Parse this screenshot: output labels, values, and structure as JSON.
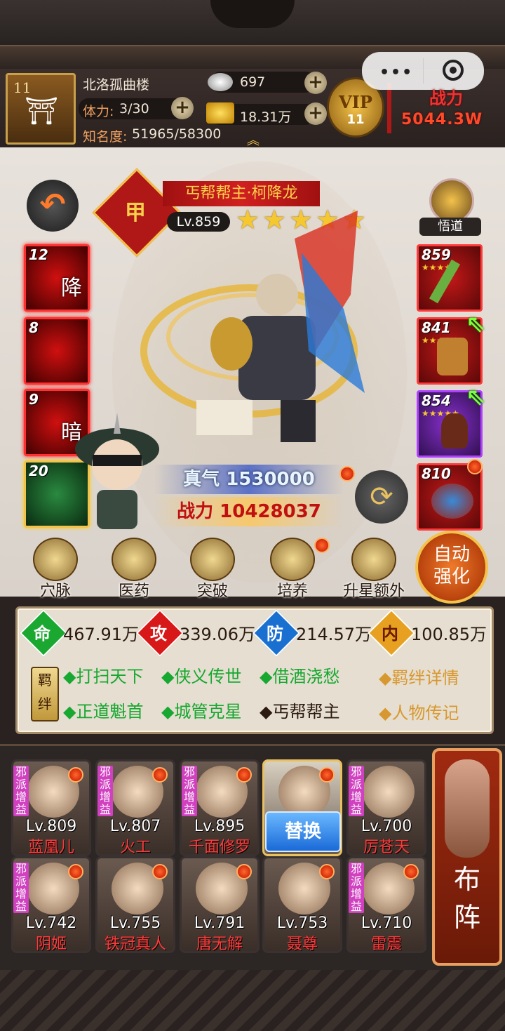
{
  "header": {
    "level": "11",
    "location": "北洛孤曲楼",
    "stamina_label": "体力:",
    "stamina_value": "3/30",
    "fame_label": "知名度:",
    "fame_value": "51965/58300",
    "silver": "697",
    "gold": "18.31万",
    "vip_label": "VIP",
    "vip_level": "11",
    "power_label": "战力",
    "power_value": "5044.3W"
  },
  "hero": {
    "rank": "甲",
    "name": "丐帮帮主·柯降龙",
    "level": "Lv.859",
    "stars": 5,
    "zhenqi": "真气 1530000",
    "zhanli": "战力 10428037",
    "wudao_label": "悟道"
  },
  "skills": [
    {
      "level": "12",
      "char": "降"
    },
    {
      "level": "8",
      "char": ""
    },
    {
      "level": "9",
      "char": "暗"
    },
    {
      "level": "20",
      "char": ""
    }
  ],
  "equipment": [
    {
      "level": "859"
    },
    {
      "level": "841"
    },
    {
      "level": "854"
    },
    {
      "level": "810"
    }
  ],
  "features": [
    {
      "label": "穴脉"
    },
    {
      "label": "医药"
    },
    {
      "label": "突破"
    },
    {
      "label": "培养"
    },
    {
      "label": "升星额外"
    }
  ],
  "auto_strengthen": {
    "line1": "自动",
    "line2": "强化"
  },
  "stats": [
    {
      "icon": "命",
      "value": "467.91万",
      "color": "#1aa830"
    },
    {
      "icon": "攻",
      "value": "339.06万",
      "color": "#d81818"
    },
    {
      "icon": "防",
      "value": "214.57万",
      "color": "#1a70d0"
    },
    {
      "icon": "内",
      "value": "100.85万",
      "color": "#e8a020"
    }
  ],
  "fetters": {
    "label": "羁绊",
    "row1": [
      "◆打扫天下",
      "◆侠义传世",
      "◆借酒浇愁"
    ],
    "row2": [
      "◆正道魁首",
      "◆城管克星",
      "◆丐帮帮主"
    ],
    "detail_link": "◆羁绊详情",
    "bio_link": "◆人物传记"
  },
  "roster": {
    "tag": "邪派增益",
    "swap_label": "替换",
    "formation_label": "布阵",
    "cards": [
      {
        "level": "Lv.809",
        "name": "蓝凰儿",
        "tag": true
      },
      {
        "level": "Lv.807",
        "name": "火工",
        "tag": true
      },
      {
        "level": "Lv.895",
        "name": "千面修罗",
        "tag": true
      },
      {
        "level": "",
        "name": "",
        "tag": false
      },
      {
        "level": "Lv.700",
        "name": "厉苍天",
        "tag": true
      },
      {
        "level": "Lv.742",
        "name": "阴姬",
        "tag": true
      },
      {
        "level": "Lv.755",
        "name": "铁冠真人",
        "tag": false
      },
      {
        "level": "Lv.791",
        "name": "唐无解",
        "tag": false
      },
      {
        "level": "Lv.753",
        "name": "聂尊",
        "tag": false
      },
      {
        "level": "Lv.710",
        "name": "雷震",
        "tag": true
      }
    ]
  }
}
